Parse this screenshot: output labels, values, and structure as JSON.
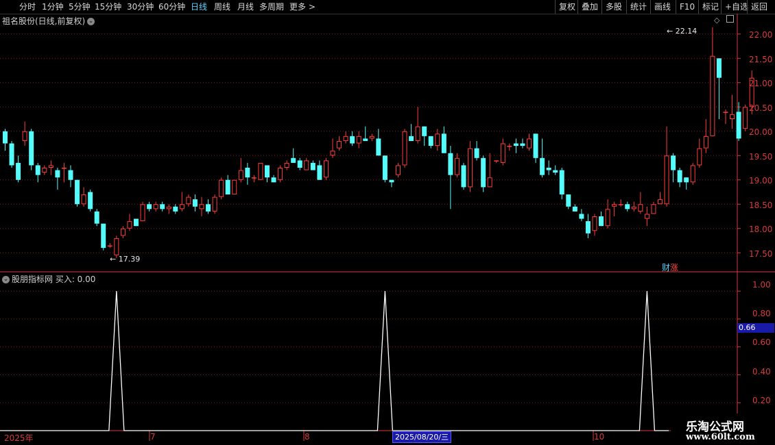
{
  "toolbar": {
    "periods": [
      "分时",
      "1分钟",
      "5分钟",
      "15分钟",
      "30分钟",
      "60分钟",
      "日线",
      "周线",
      "月线",
      "多周期",
      "更多 >"
    ],
    "active_period": "日线",
    "right_buttons": [
      "复权",
      "叠加",
      "多股",
      "统计",
      "画线",
      "F10",
      "标记",
      "+自选",
      "返回"
    ]
  },
  "kline_panel": {
    "title": "祖名股份(日线,前复权)",
    "y_ticks": [
      "22.00",
      "21.50",
      "21.00",
      "20.50",
      "20.00",
      "19.50",
      "19.00",
      "18.50",
      "18.00",
      "17.50"
    ],
    "high_label": "22.14",
    "low_label": "17.39",
    "badge_left": "财",
    "badge_right": "涨"
  },
  "indicator_panel": {
    "title": "股朋指标网 买入: 0.00",
    "y_ticks": [
      "1.00",
      "0.80",
      "0.60",
      "0.40",
      "0.20"
    ],
    "current_value": "0.66"
  },
  "x_axis": {
    "labels": [
      "2025年",
      "7",
      "8",
      "10"
    ],
    "cursor_date": "2025/08/20/三"
  },
  "watermark": {
    "line1": "乐淘公式网",
    "line2": "www.60lt.com"
  },
  "colors": {
    "up": "#ff3c3c",
    "down": "#54fcfc",
    "grid": "#8b1a1a",
    "axis": "#d83a3a"
  },
  "chart_data": {
    "type": "candlestick",
    "y_range": [
      17.25,
      22.25
    ],
    "candles": [
      [
        20.0,
        19.75,
        20.05,
        19.6
      ],
      [
        19.75,
        19.3,
        19.8,
        19.25
      ],
      [
        19.35,
        19.0,
        19.5,
        18.95
      ],
      [
        19.8,
        20.0,
        20.2,
        19.7
      ],
      [
        20.0,
        19.3,
        20.05,
        19.2
      ],
      [
        19.3,
        19.1,
        19.35,
        18.95
      ],
      [
        19.15,
        19.25,
        19.3,
        19.1
      ],
      [
        19.25,
        19.3,
        19.4,
        19.1
      ],
      [
        19.2,
        19.05,
        19.25,
        18.8
      ],
      [
        19.25,
        19.25,
        19.35,
        18.95
      ],
      [
        19.2,
        19.0,
        19.3,
        18.85
      ],
      [
        19.0,
        18.5,
        19.0,
        18.45
      ],
      [
        18.5,
        18.7,
        18.85,
        18.45
      ],
      [
        18.75,
        18.4,
        18.8,
        18.35
      ],
      [
        18.35,
        18.1,
        18.4,
        18.05
      ],
      [
        18.1,
        17.6,
        18.1,
        17.55
      ],
      [
        17.65,
        17.65,
        17.7,
        17.6
      ],
      [
        17.45,
        17.8,
        17.85,
        17.39
      ],
      [
        17.85,
        18.0,
        18.05,
        17.8
      ],
      [
        18.0,
        18.15,
        18.3,
        17.95
      ],
      [
        18.2,
        18.05,
        18.2,
        18.05
      ],
      [
        18.15,
        18.5,
        18.55,
        18.15
      ],
      [
        18.5,
        18.4,
        18.55,
        18.35
      ],
      [
        18.4,
        18.5,
        18.55,
        18.35
      ],
      [
        18.5,
        18.4,
        18.55,
        18.35
      ],
      [
        18.4,
        18.45,
        18.5,
        18.3
      ],
      [
        18.45,
        18.35,
        18.5,
        18.3
      ],
      [
        18.4,
        18.5,
        18.75,
        18.35
      ],
      [
        18.5,
        18.65,
        18.7,
        18.45
      ],
      [
        18.6,
        18.45,
        18.7,
        18.35
      ],
      [
        18.4,
        18.5,
        18.65,
        18.25
      ],
      [
        18.5,
        18.35,
        18.6,
        18.3
      ],
      [
        18.35,
        18.65,
        18.7,
        18.3
      ],
      [
        18.65,
        19.0,
        19.05,
        18.6
      ],
      [
        19.0,
        18.7,
        19.1,
        18.7
      ],
      [
        18.7,
        19.0,
        19.0,
        18.7
      ],
      [
        19.0,
        19.2,
        19.45,
        18.95
      ],
      [
        19.25,
        19.05,
        19.35,
        18.9
      ],
      [
        19.05,
        19.05,
        19.1,
        18.95
      ],
      [
        19.0,
        19.35,
        19.35,
        19.0
      ],
      [
        19.3,
        19.05,
        19.3,
        18.95
      ],
      [
        19.05,
        18.95,
        19.1,
        18.95
      ],
      [
        19.0,
        19.25,
        19.3,
        18.95
      ],
      [
        19.25,
        19.35,
        19.4,
        19.2
      ],
      [
        19.45,
        19.35,
        19.65,
        19.35
      ],
      [
        19.4,
        19.25,
        19.45,
        19.2
      ],
      [
        19.2,
        19.4,
        19.45,
        19.2
      ],
      [
        19.35,
        19.2,
        19.4,
        19.2
      ],
      [
        19.3,
        19.0,
        19.4,
        19.0
      ],
      [
        19.05,
        19.4,
        19.45,
        19.0
      ],
      [
        19.5,
        19.6,
        19.85,
        19.45
      ],
      [
        19.65,
        19.8,
        19.9,
        19.6
      ],
      [
        19.8,
        19.9,
        20.0,
        19.75
      ],
      [
        19.9,
        19.75,
        20.0,
        19.7
      ],
      [
        19.75,
        19.9,
        20.0,
        19.65
      ],
      [
        19.85,
        19.8,
        20.1,
        19.8
      ],
      [
        19.85,
        19.9,
        19.95,
        19.8
      ],
      [
        19.85,
        19.5,
        20.05,
        19.5
      ],
      [
        19.5,
        19.0,
        19.5,
        18.95
      ],
      [
        19.0,
        18.95,
        19.0,
        18.85
      ],
      [
        19.1,
        19.3,
        19.35,
        19.05
      ],
      [
        19.3,
        20.0,
        20.05,
        19.25
      ],
      [
        19.9,
        19.8,
        20.15,
        19.8
      ],
      [
        19.8,
        20.1,
        20.5,
        19.75
      ],
      [
        20.1,
        19.9,
        20.1,
        19.7
      ],
      [
        19.9,
        19.7,
        19.9,
        19.65
      ],
      [
        19.7,
        19.95,
        20.05,
        19.6
      ],
      [
        19.95,
        19.55,
        20.1,
        19.55
      ],
      [
        19.55,
        19.1,
        19.7,
        18.4
      ],
      [
        19.1,
        19.45,
        19.55,
        19.05
      ],
      [
        19.3,
        18.85,
        19.35,
        18.8
      ],
      [
        18.85,
        19.65,
        19.8,
        18.75
      ],
      [
        19.65,
        19.45,
        19.8,
        19.4
      ],
      [
        19.45,
        18.85,
        19.5,
        18.75
      ],
      [
        18.85,
        19.05,
        19.55,
        18.85
      ],
      [
        19.4,
        19.4,
        19.4,
        19.35
      ],
      [
        19.35,
        19.75,
        19.85,
        19.3
      ],
      [
        19.7,
        19.7,
        19.75,
        19.6
      ],
      [
        19.75,
        19.7,
        19.85,
        19.55
      ],
      [
        19.75,
        19.7,
        19.85,
        19.65
      ],
      [
        19.65,
        19.85,
        19.95,
        19.6
      ],
      [
        19.95,
        19.45,
        19.95,
        19.35
      ],
      [
        19.45,
        19.1,
        19.85,
        19.05
      ],
      [
        19.25,
        19.2,
        19.4,
        19.1
      ],
      [
        19.2,
        19.15,
        19.3,
        19.1
      ],
      [
        19.2,
        18.7,
        19.25,
        18.6
      ],
      [
        18.7,
        18.45,
        18.7,
        18.4
      ],
      [
        18.45,
        18.35,
        18.5,
        18.35
      ],
      [
        18.3,
        18.2,
        18.4,
        18.15
      ],
      [
        18.15,
        17.9,
        18.3,
        17.8
      ],
      [
        17.95,
        18.25,
        18.3,
        17.85
      ],
      [
        18.25,
        18.05,
        18.35,
        18.05
      ],
      [
        18.05,
        18.4,
        18.6,
        18.0
      ],
      [
        18.45,
        18.5,
        18.55,
        18.25
      ],
      [
        18.5,
        18.5,
        18.6,
        18.45
      ],
      [
        18.5,
        18.4,
        18.55,
        18.35
      ],
      [
        18.4,
        18.45,
        18.55,
        18.35
      ],
      [
        18.35,
        18.5,
        18.75,
        18.3
      ],
      [
        18.2,
        18.3,
        18.45,
        18.05
      ],
      [
        18.3,
        18.5,
        18.55,
        18.3
      ],
      [
        18.5,
        18.6,
        18.75,
        18.5
      ],
      [
        18.5,
        19.5,
        20.1,
        18.45
      ],
      [
        19.5,
        19.2,
        19.55,
        18.95
      ],
      [
        19.2,
        18.95,
        19.25,
        18.85
      ],
      [
        19.05,
        18.95,
        19.05,
        18.8
      ],
      [
        18.95,
        19.3,
        19.35,
        18.9
      ],
      [
        19.3,
        19.65,
        19.85,
        19.25
      ],
      [
        19.65,
        19.9,
        20.25,
        19.55
      ],
      [
        19.9,
        21.55,
        22.14,
        19.9
      ],
      [
        21.5,
        21.1,
        21.5,
        20.25
      ],
      [
        20.4,
        20.4,
        20.45,
        20.15
      ],
      [
        20.25,
        20.35,
        20.75,
        20.05
      ],
      [
        20.4,
        19.85,
        20.6,
        19.8
      ],
      [
        20.05,
        20.5,
        20.55,
        20.0
      ],
      [
        20.5,
        21.1,
        21.25,
        20.35
      ]
    ],
    "indicator_spikes": [
      {
        "x_index": 17,
        "value": 1.0
      },
      {
        "x_index": 58,
        "value": 1.0
      },
      {
        "x_index": 98,
        "value": 1.0
      }
    ],
    "indicator_range": [
      0,
      1.05
    ]
  }
}
